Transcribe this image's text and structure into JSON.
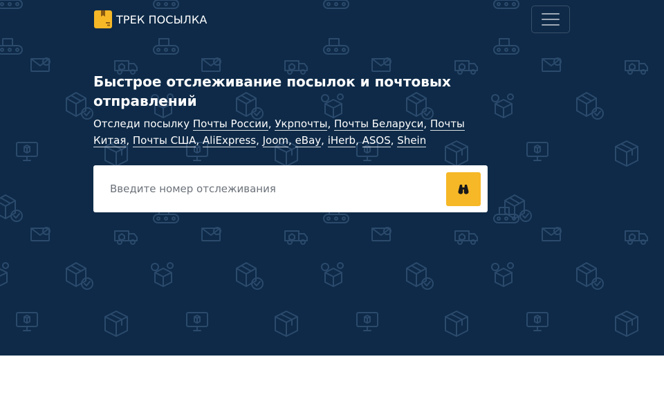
{
  "navbar": {
    "brand_name": "ТРЕК ПОСЫЛКА",
    "brand_logo_icon": "package-box-icon",
    "menu_icon": "hamburger-menu-icon"
  },
  "hero": {
    "title": "Быстрое отслеживание посылок и почтовых отправлений",
    "subtitle_prefix": "Отследи посылку ",
    "carriers": [
      {
        "label": "Почты России"
      },
      {
        "label": "Укрпочты"
      },
      {
        "label": "Почты Беларуси"
      },
      {
        "label": "Почты Китая"
      },
      {
        "label": "Почты США"
      },
      {
        "label": "AliExpress"
      },
      {
        "label": "Joom"
      },
      {
        "label": "eBay"
      },
      {
        "label": "iHerb"
      },
      {
        "label": "ASOS"
      },
      {
        "label": "Shein"
      }
    ],
    "separator": ", "
  },
  "search": {
    "placeholder": "Введите номер отслеживания",
    "value": "",
    "button_icon": "binoculars-icon"
  },
  "colors": {
    "hero_background": "#0e2a48",
    "pattern_stroke": "#2b4a6c",
    "accent": "#f6b827",
    "text_light": "#ffffff"
  }
}
